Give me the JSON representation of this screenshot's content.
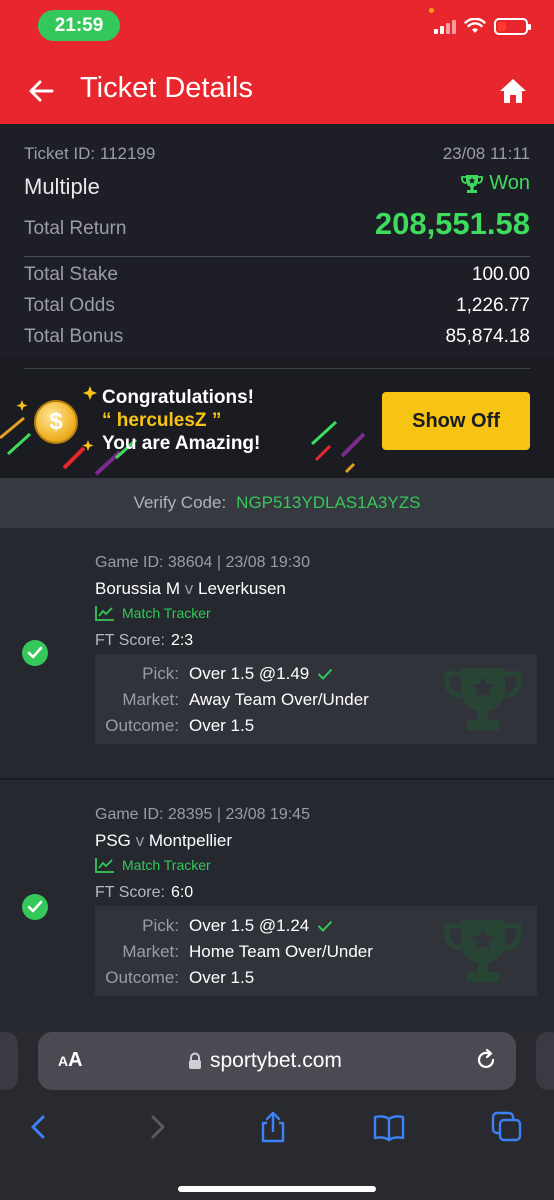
{
  "status": {
    "time": "21:59"
  },
  "header": {
    "title": "Ticket Details"
  },
  "ticket": {
    "id_label": "Ticket ID: 112199",
    "datetime": "23/08 11:11",
    "type": "Multiple",
    "result": "Won",
    "total_return_label": "Total Return",
    "total_return": "208,551.58",
    "rows": [
      {
        "label": "Total Stake",
        "value": "100.00"
      },
      {
        "label": "Total Odds",
        "value": "1,226.77"
      },
      {
        "label": "Total Bonus",
        "value": "85,874.18"
      }
    ]
  },
  "banner": {
    "line1": "Congratulations!",
    "username": "“ herculesZ ”",
    "line3": "You are Amazing!",
    "button": "Show Off",
    "coin_symbol": "$"
  },
  "verify": {
    "label": "Verify Code:",
    "code": "NGP513YDLAS1A3YZS"
  },
  "games": [
    {
      "game_id": "Game ID: 38604 | 23/08 19:30",
      "home": "Borussia M",
      "vs": "v",
      "away": "Leverkusen",
      "tracker": "Match Tracker",
      "ft_label": "FT Score:",
      "ft_score": "2:3",
      "pick_label": "Pick:",
      "pick": "Over 1.5 @1.49",
      "market_label": "Market:",
      "market": "Away Team Over/Under",
      "outcome_label": "Outcome:",
      "outcome": "Over 1.5"
    },
    {
      "game_id": "Game ID: 28395 | 23/08 19:45",
      "home": "PSG",
      "vs": "v",
      "away": "Montpellier",
      "tracker": "Match Tracker",
      "ft_label": "FT Score:",
      "ft_score": "6:0",
      "pick_label": "Pick:",
      "pick": "Over 1.5 @1.24",
      "market_label": "Market:",
      "market": "Home Team Over/Under",
      "outcome_label": "Outcome:",
      "outcome": "Over 1.5"
    }
  ],
  "browser": {
    "aa_small": "A",
    "aa_big": "A",
    "url": "sportybet.com"
  },
  "colors": {
    "brand_red": "#e8262e",
    "win_green": "#34c759",
    "accent_yellow": "#f7c413"
  }
}
